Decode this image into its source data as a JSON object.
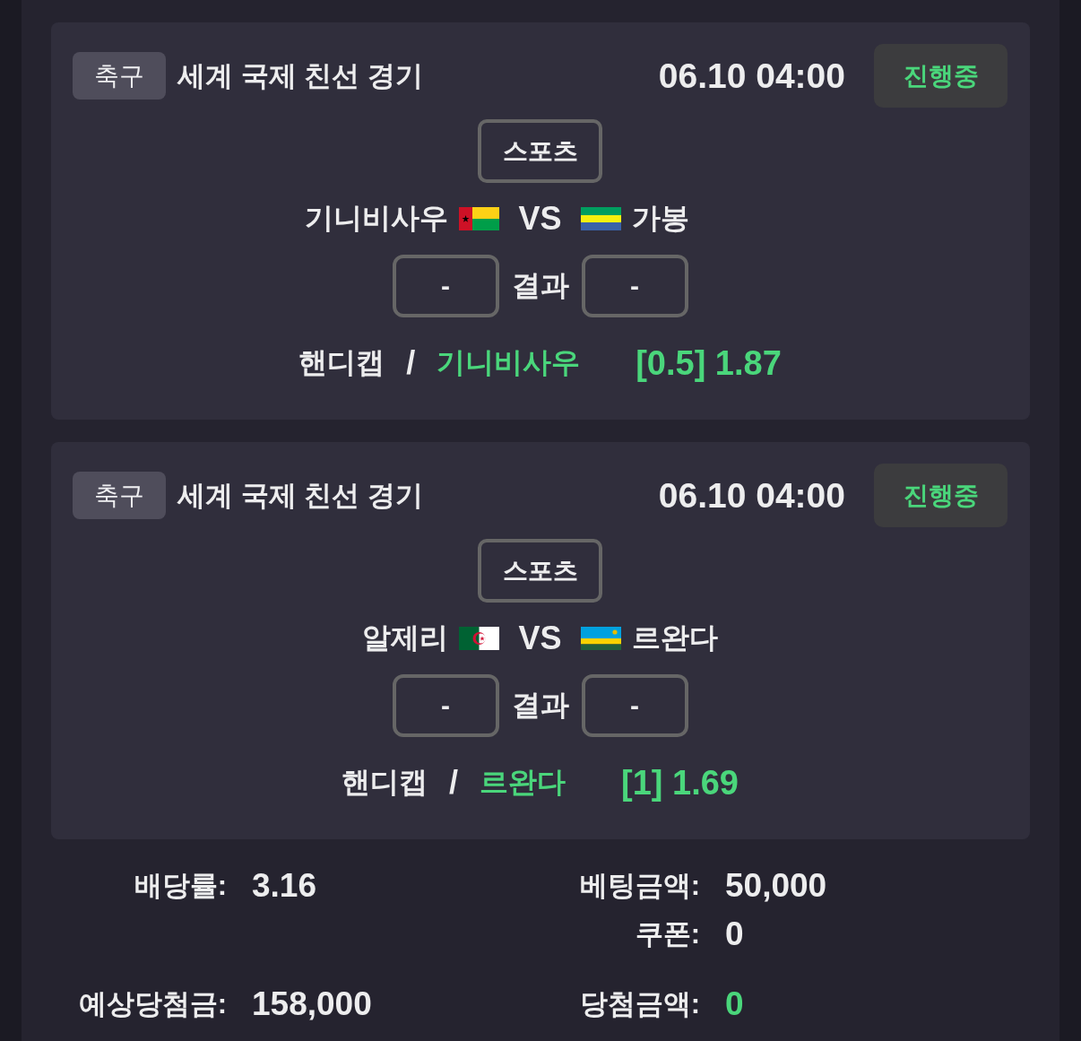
{
  "matches": [
    {
      "sport": "축구",
      "league": "세계 국제 친선 경기",
      "time": "06.10 04:00",
      "status": {
        "label": "진행중",
        "kind": "live"
      },
      "category": "스포츠",
      "home": {
        "name": "기니비사우",
        "kind": "gw"
      },
      "vs": "VS",
      "away": {
        "name": "가봉",
        "kind": "ga"
      },
      "home_score": "-",
      "result_label": "결과",
      "away_score": "-",
      "handicap": {
        "label": "핸디캡",
        "separator": "/",
        "pick": "기니비사우",
        "odds": "[0.5] 1.87"
      }
    },
    {
      "sport": "축구",
      "league": "세계 국제 친선 경기",
      "time": "06.10 04:00",
      "status": {
        "label": "진행중",
        "kind": "live"
      },
      "category": "스포츠",
      "home": {
        "name": "알제리",
        "kind": "dz"
      },
      "vs": "VS",
      "away": {
        "name": "르완다",
        "kind": "rw"
      },
      "home_score": "-",
      "result_label": "결과",
      "away_score": "-",
      "handicap": {
        "label": "핸디캡",
        "separator": "/",
        "pick": "르완다",
        "odds": "[1] 1.69"
      }
    }
  ],
  "summary": [
    {
      "left": [
        {
          "label": "배당률:",
          "value": "3.16",
          "highlight": false
        }
      ],
      "right": [
        {
          "label": "베팅금액:",
          "value": "50,000",
          "highlight": false
        },
        {
          "label": "쿠폰:",
          "value": "0",
          "highlight": false
        }
      ]
    },
    {
      "left": [
        {
          "label": "예상당첨금:",
          "value": "158,000",
          "highlight": false
        }
      ],
      "right": [
        {
          "label": "당첨금액:",
          "value": "0",
          "highlight": true
        }
      ]
    }
  ]
}
